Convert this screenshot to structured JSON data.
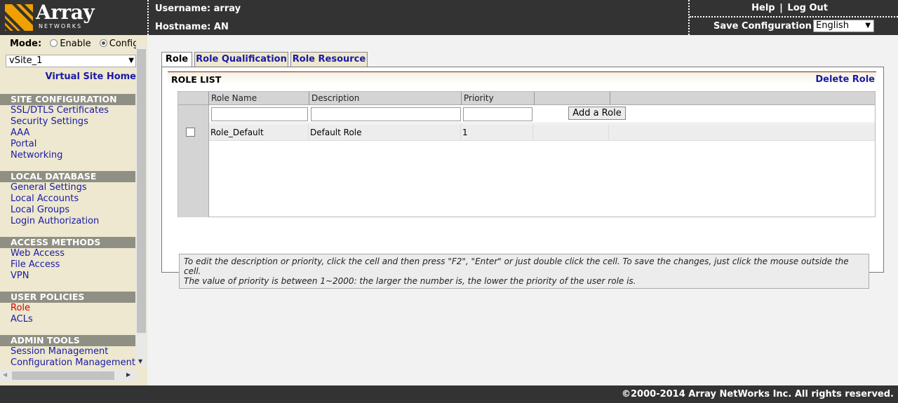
{
  "header": {
    "logo_word": "Array",
    "logo_sub": "NETWORKS",
    "username_label": "Username: array",
    "hostname_label": "Hostname: AN",
    "help_label": "Help",
    "separator": "|",
    "logout_label": "Log Out",
    "save_config_label": "Save Configuration |",
    "language_selected": "English"
  },
  "sidebar": {
    "mode_label": "Mode:",
    "mode_enable": "Enable",
    "mode_config": "Config",
    "vsite_selected": "vSite_1",
    "vsite_home": "Virtual Site Home",
    "sections": [
      {
        "title": "SITE CONFIGURATION",
        "items": [
          "SSL/DTLS Certificates",
          "Security Settings",
          "AAA",
          "Portal",
          "Networking"
        ]
      },
      {
        "title": "LOCAL DATABASE",
        "items": [
          "General Settings",
          "Local Accounts",
          "Local Groups",
          "Login Authorization"
        ]
      },
      {
        "title": "ACCESS METHODS",
        "items": [
          "Web Access",
          "File Access",
          "VPN"
        ]
      },
      {
        "title": "USER POLICIES",
        "items": [
          "Role",
          "ACLs"
        ]
      },
      {
        "title": "ADMIN TOOLS",
        "items": [
          "Session Management",
          "Configuration Management"
        ]
      }
    ]
  },
  "main": {
    "tabs": [
      "Role",
      "Role Qualification",
      "Role Resource"
    ],
    "role_list_title": "ROLE LIST",
    "delete_role_label": "Delete Role",
    "grid": {
      "columns": [
        "Role Name",
        "Description",
        "Priority"
      ],
      "add_button_label": "Add a Role",
      "rows": [
        {
          "name": "Role_Default",
          "description": "Default Role",
          "priority": "1"
        }
      ]
    },
    "note_line1": "To edit the description or priority, click the cell and then press \"F2\", \"Enter\" or just double click the cell. To save the changes, just click the mouse outside the cell.",
    "note_line2": "The value of priority is between 1~2000: the larger the number is, the lower the priority of the user role is."
  },
  "footer": {
    "copyright": "©2000-2014 Array NetWorks Inc. All rights reserved."
  },
  "colors": {
    "header_bg": "#333333",
    "sidebar_bg": "#ede8cf",
    "link_blue": "#1a1aa6",
    "active_red": "#cc0000",
    "logo_orange": "#f0a000"
  }
}
